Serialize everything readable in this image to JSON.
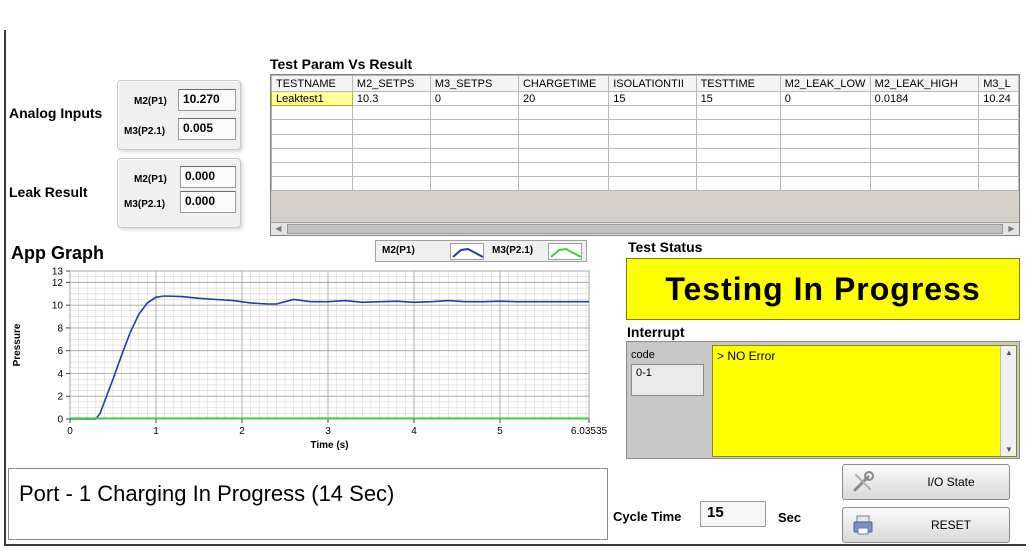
{
  "analog_inputs": {
    "label": "Analog Inputs",
    "rows": [
      {
        "label": "M2(P1)",
        "value": "10.270"
      },
      {
        "label": "M3(P2.1)",
        "value": "0.005"
      }
    ]
  },
  "leak_result": {
    "label": "Leak Result",
    "rows": [
      {
        "label": "M2(P1)",
        "value": "0.000"
      },
      {
        "label": "M3(P2.1)",
        "value": "0.000"
      }
    ]
  },
  "table": {
    "title": "Test Param Vs Result",
    "columns": [
      "TESTNAME",
      "M2_SETPS",
      "M3_SETPS",
      "CHARGETIME",
      "ISOLATIONTII",
      "TESTTIME",
      "M2_LEAK_LOW",
      "M2_LEAK_HIGH",
      "M3_L"
    ],
    "rows": [
      [
        "Leaktest1",
        "10.3",
        "0",
        "20",
        "15",
        "15",
        "0",
        "0.0184",
        "10.24"
      ]
    ],
    "empty_rows": 6
  },
  "graph": {
    "title": "App Graph",
    "legend": [
      {
        "name": "M2(P1)",
        "color": "#1e3fa8"
      },
      {
        "name": "M3(P2.1)",
        "color": "#3cd43c"
      }
    ]
  },
  "chart_data": {
    "type": "line",
    "title": "",
    "xlabel": "Time (s)",
    "ylabel": "Pressure",
    "xlim": [
      0,
      6.03535
    ],
    "ylim": [
      0,
      13
    ],
    "x_ticks": [
      "0",
      "1",
      "2",
      "3",
      "4",
      "5",
      "6.03535"
    ],
    "x_tick_values": [
      0,
      1,
      2,
      3,
      4,
      5,
      6.03535
    ],
    "y_ticks": [
      "0",
      "2",
      "4",
      "6",
      "8",
      "10",
      "12",
      "13"
    ],
    "y_tick_values": [
      0,
      2,
      4,
      6,
      8,
      10,
      12,
      13
    ],
    "grid": true,
    "series": [
      {
        "name": "M2(P1)",
        "color": "#1e3fa8",
        "x": [
          0,
          0.3,
          0.35,
          0.4,
          0.5,
          0.6,
          0.7,
          0.8,
          0.9,
          1.0,
          1.1,
          1.3,
          1.5,
          1.7,
          1.9,
          2.1,
          2.3,
          2.4,
          2.5,
          2.6,
          2.8,
          3.0,
          3.2,
          3.4,
          3.6,
          3.8,
          4.0,
          4.2,
          4.4,
          4.6,
          4.8,
          5.0,
          5.2,
          5.4,
          5.6,
          5.8,
          6.03535
        ],
        "y": [
          0,
          0,
          0.5,
          1.5,
          3.5,
          5.6,
          7.6,
          9.2,
          10.2,
          10.7,
          10.8,
          10.75,
          10.6,
          10.5,
          10.4,
          10.2,
          10.1,
          10.1,
          10.3,
          10.5,
          10.3,
          10.3,
          10.4,
          10.25,
          10.3,
          10.35,
          10.25,
          10.3,
          10.4,
          10.3,
          10.3,
          10.35,
          10.3,
          10.3,
          10.3,
          10.3,
          10.3
        ]
      },
      {
        "name": "M3(P2.1)",
        "color": "#3cd43c",
        "x": [
          0,
          6.03535
        ],
        "y": [
          0.05,
          0.05
        ]
      }
    ]
  },
  "test_status": {
    "title": "Test Status",
    "text": "Testing In Progress"
  },
  "interrupt": {
    "title": "Interrupt",
    "code_label": "code",
    "code_value": "0-1",
    "message": "> NO Error"
  },
  "message": "Port - 1 Charging In Progress (14 Sec)",
  "cycle_time": {
    "label": "Cycle Time",
    "value": "15",
    "unit": "Sec"
  },
  "buttons": {
    "io_state": "I/O State",
    "reset": "RESET"
  }
}
